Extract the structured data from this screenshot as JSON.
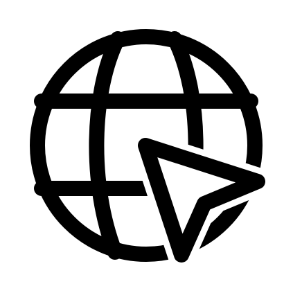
{
  "icon": {
    "name": "globe-with-cursor-icon",
    "meaning": "web",
    "parts": [
      "globe-icon",
      "cursor-arrow-icon"
    ]
  },
  "colors": {
    "background": "#ffffff",
    "stroke": "#000000"
  }
}
